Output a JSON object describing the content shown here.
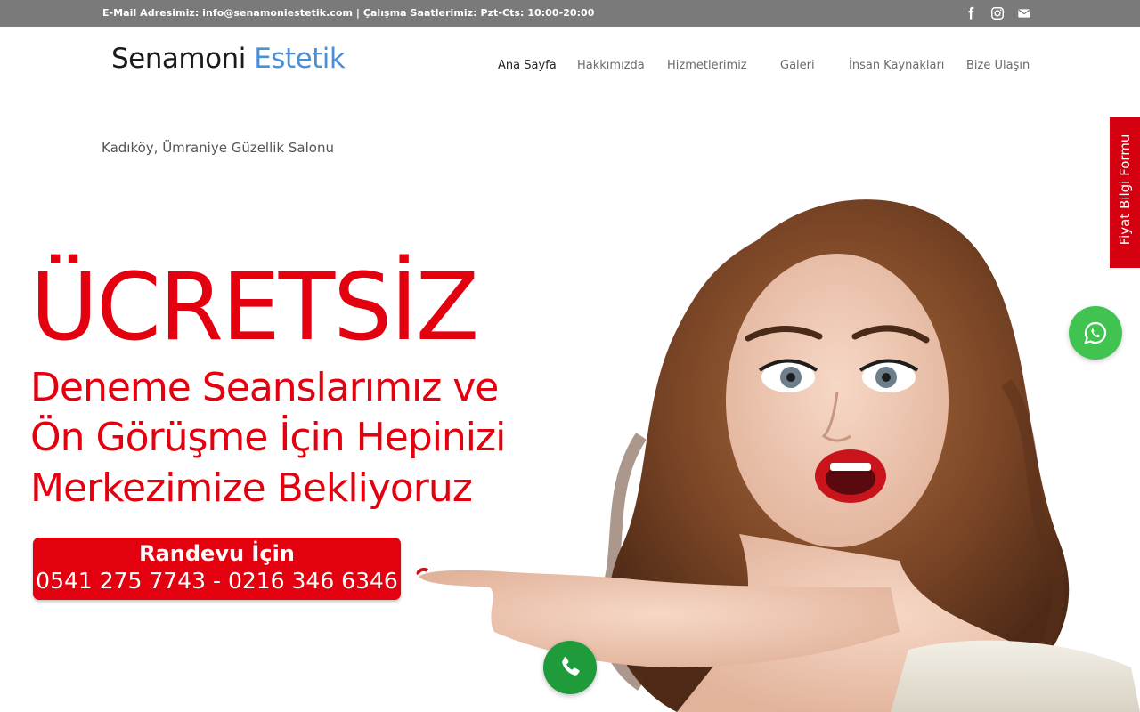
{
  "topbar": {
    "info_text": "E-Mail Adresimiz: info@senamoniestetik.com | Çalışma Saatlerimiz: Pzt-Cts: 10:00-20:00",
    "socials": [
      "facebook-icon",
      "instagram-icon",
      "mail-icon"
    ]
  },
  "header": {
    "logo_part1": "Senamoni",
    "logo_part2": "Estetik",
    "nav": [
      "Ana Sayfa",
      "Hakkımızda",
      "Hizmetlerimiz",
      "Galeri",
      "İnsan Kaynakları",
      "Bize Ulaşın"
    ],
    "active_nav": "Ana Sayfa"
  },
  "tagline": "Kadıköy, Ümraniye Güzellik Salonu",
  "hero": {
    "headline": "ÜCRETSİZ",
    "line1": "Deneme Seanslarımız ve",
    "line2": "Ön Görüşme İçin Hepinizi",
    "line3": "Merkezimize Bekliyoruz",
    "cta_title": "Randevu İçin",
    "cta_phones": "0541 275 7743 - 0216 346 6346",
    "image": "smiling-woman-pointing-photo"
  },
  "sidetab": {
    "label": "Fiyat Bilgi Formu"
  },
  "floating": {
    "whatsapp": "whatsapp-icon",
    "call": "phone-icon"
  },
  "colors": {
    "accent_red": "#e3000f",
    "logo_blue": "#4a90d9",
    "topbar_gray": "#7a7a7a",
    "whatsapp_green": "#40c351",
    "call_green": "#1f9b3b"
  }
}
